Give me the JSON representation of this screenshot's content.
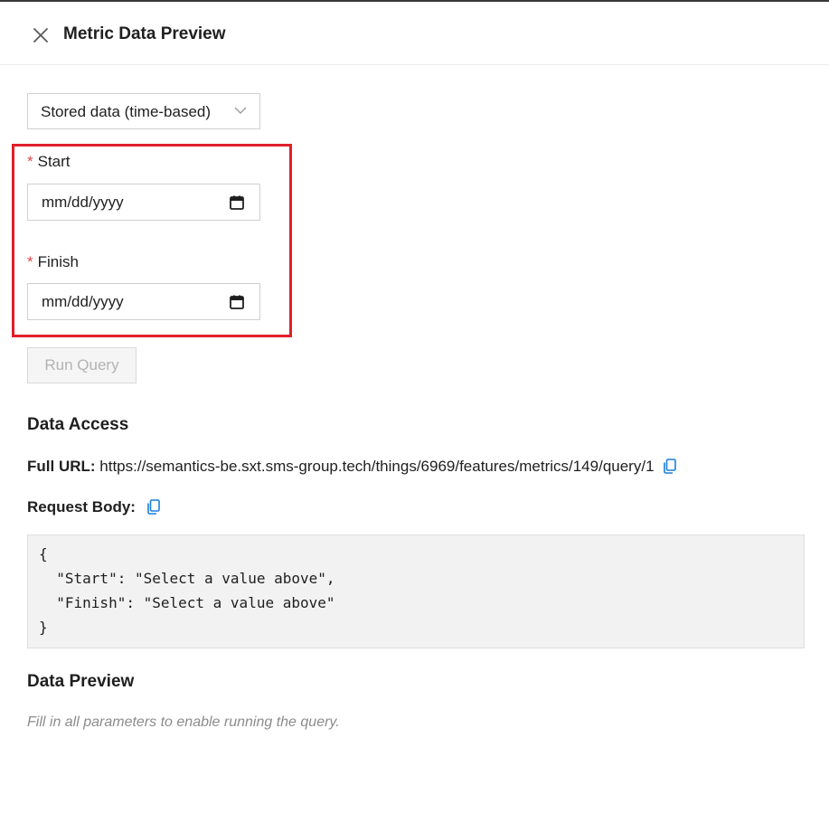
{
  "header": {
    "title": "Metric Data Preview",
    "close_icon": "close-icon"
  },
  "source_select": {
    "value": "Stored data (time-based)"
  },
  "fields": {
    "start": {
      "required_mark": "*",
      "label": "Start",
      "value": "mm/dd/yyyy"
    },
    "finish": {
      "required_mark": "*",
      "label": "Finish",
      "value": "mm/dd/yyyy"
    }
  },
  "run_button": {
    "label": "Run Query",
    "disabled": true
  },
  "data_access": {
    "title": "Data Access",
    "full_url_label": "Full URL:",
    "full_url": "https://semantics-be.sxt.sms-group.tech/things/6969/features/metrics/149/query/1",
    "request_body_label": "Request Body:",
    "request_body_lines": [
      "{",
      "  \"Start\": \"Select a value above\",",
      "  \"Finish\": \"Select a value above\"",
      "}"
    ]
  },
  "data_preview": {
    "title": "Data Preview",
    "hint": "Fill in all parameters to enable running the query."
  },
  "colors": {
    "highlight": "#e0202a",
    "required": "#e04848",
    "copy_icon": "#1a7fdc"
  }
}
